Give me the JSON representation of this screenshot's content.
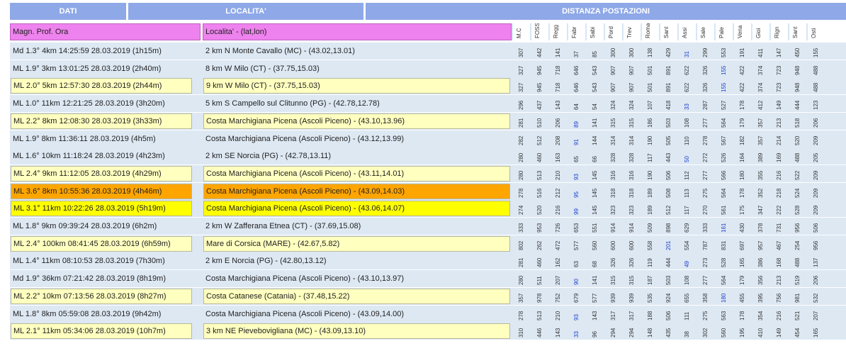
{
  "header": {
    "dati": "DATI",
    "localita": "LOCALITA'",
    "distanza": "DISTANZA POSTAZIONI"
  },
  "columns": {
    "c1": "Magn. Prof. Ora",
    "c2": "Localita' - (lat,lon)"
  },
  "stations": [
    "M.C",
    "FOSS",
    "Regg",
    "Fabr",
    "Sabi",
    "Pord",
    "Trev",
    "Roma",
    "Sant",
    "Assi",
    "Sale",
    "Pale",
    "Vena",
    "Gioi",
    "Rign",
    "Sant",
    "Osti"
  ],
  "colors": {
    "header_blue": "#8ea8e8",
    "magenta": "#ee82ee",
    "row_bg": "#dde8f3",
    "pale_yellow": "#ffffc0",
    "orange": "#ffa500",
    "yellow": "#ffff00",
    "blue_number": "#1a3dcc"
  },
  "rows": [
    {
      "info": "Md 1.3° 4km 14:25:59 28.03.2019 (1h15m)",
      "loc": "2 km N Monte Cavallo (MC) - (43.02,13.01)",
      "hl": "",
      "blue": 9,
      "d": [
        "307",
        "442",
        "141",
        "37",
        "85",
        "300",
        "300",
        "138",
        "429",
        "31",
        "299",
        "553",
        "191",
        "411",
        "147",
        "450",
        "155"
      ]
    },
    {
      "info": "ML 1.9° 3km 13:01:25 28.03.2019 (2h40m)",
      "loc": "8 km W Milo (CT) - (37.75,15.03)",
      "hl": "",
      "blue": 11,
      "d": [
        "327",
        "945",
        "718",
        "646",
        "543",
        "907",
        "907",
        "501",
        "891",
        "622",
        "326",
        "155",
        "422",
        "374",
        "723",
        "948",
        "488"
      ]
    },
    {
      "info": "ML 2.0° 5km 12:57:30 28.03.2019 (2h44m)",
      "loc": "9 km W Milo (CT) - (37.75,15.03)",
      "hl": "pale",
      "blue": 11,
      "d": [
        "327",
        "945",
        "718",
        "646",
        "543",
        "907",
        "907",
        "501",
        "891",
        "622",
        "326",
        "155",
        "422",
        "374",
        "723",
        "948",
        "488"
      ]
    },
    {
      "info": "ML 1.0° 11km 12:21:25 28.03.2019 (3h20m)",
      "loc": "5 km S Campello sul Clitunno (PG) - (42.78,12.78)",
      "hl": "",
      "blue": 9,
      "d": [
        "296",
        "437",
        "143",
        "64",
        "54",
        "324",
        "324",
        "107",
        "418",
        "33",
        "287",
        "527",
        "178",
        "412",
        "149",
        "444",
        "123"
      ]
    },
    {
      "info": "ML 2.2° 8km 12:08:30 28.03.2019 (3h33m)",
      "loc": "Costa Marchigiana Picena (Ascoli Piceno) - (43.10,13.96)",
      "hl": "pale",
      "blue": 3,
      "d": [
        "281",
        "510",
        "206",
        "89",
        "141",
        "315",
        "315",
        "186",
        "503",
        "108",
        "277",
        "564",
        "179",
        "357",
        "213",
        "518",
        "206"
      ]
    },
    {
      "info": "ML 1.9° 8km 11:36:11 28.03.2019 (4h5m)",
      "loc": "Costa Marchigiana Picena (Ascoli Piceno) - (43.12,13.99)",
      "hl": "",
      "blue": 3,
      "d": [
        "282",
        "512",
        "208",
        "91",
        "144",
        "314",
        "314",
        "190",
        "505",
        "110",
        "278",
        "567",
        "182",
        "357",
        "214",
        "520",
        "209"
      ]
    },
    {
      "info": "ML 1.6° 10km 11:18:24 28.03.2019 (4h23m)",
      "loc": "2 km SE Norcia (PG) - (42.78,13.11)",
      "hl": "",
      "blue": 9,
      "d": [
        "280",
        "460",
        "163",
        "65",
        "66",
        "328",
        "328",
        "117",
        "443",
        "50",
        "272",
        "526",
        "164",
        "389",
        "169",
        "488",
        "205"
      ]
    },
    {
      "info": "ML 2.4° 9km 11:12:05 28.03.2019 (4h29m)",
      "loc": "Costa Marchigiana Picena (Ascoli Piceno) - (43.11,14.01)",
      "hl": "pale",
      "blue": 3,
      "d": [
        "280",
        "513",
        "210",
        "93",
        "145",
        "316",
        "316",
        "190",
        "506",
        "112",
        "277",
        "566",
        "180",
        "355",
        "216",
        "522",
        "209"
      ]
    },
    {
      "info": "ML 3.6° 8km 10:55:36 28.03.2019 (4h46m)",
      "loc": "Costa Marchigiana Picena (Ascoli Piceno) - (43.09,14.03)",
      "hl": "orange",
      "blue": 3,
      "d": [
        "278",
        "516",
        "212",
        "95",
        "145",
        "318",
        "318",
        "189",
        "508",
        "113",
        "275",
        "564",
        "178",
        "352",
        "218",
        "524",
        "209"
      ]
    },
    {
      "info": "ML 3.1° 11km 10:22:26 28.03.2019 (5h19m)",
      "loc": "Costa Marchigiana Picena (Ascoli Piceno) - (43.06,14.07)",
      "hl": "yellow",
      "blue": 3,
      "d": [
        "274",
        "520",
        "216",
        "99",
        "145",
        "323",
        "323",
        "189",
        "512",
        "117",
        "270",
        "561",
        "175",
        "347",
        "222",
        "528",
        "209"
      ]
    },
    {
      "info": "ML 1.8° 9km 09:39:24 28.03.2019 (6h2m)",
      "loc": "2 km W Zafferana Etnea (CT) - (37.69,15.08)",
      "hl": "",
      "blue": 11,
      "d": [
        "333",
        "953",
        "726",
        "653",
        "551",
        "914",
        "914",
        "509",
        "898",
        "629",
        "333",
        "161",
        "430",
        "378",
        "731",
        "956",
        "506"
      ]
    },
    {
      "info": "ML 2.4° 100km 08:41:45 28.03.2019 (6h59m)",
      "loc": "Mare di Corsica (MARE) - (42.67,5.82)",
      "hl": "pale",
      "blue": 8,
      "d": [
        "802",
        "262",
        "472",
        "577",
        "560",
        "600",
        "600",
        "558",
        "201",
        "554",
        "787",
        "831",
        "697",
        "957",
        "467",
        "254",
        "956"
      ]
    },
    {
      "info": "ML 1.4° 11km 08:10:53 28.03.2019 (7h30m)",
      "loc": "2 km E Norcia (PG) - (42.80,13.12)",
      "hl": "",
      "blue": 9,
      "d": [
        "281",
        "460",
        "162",
        "63",
        "68",
        "326",
        "326",
        "119",
        "444",
        "49",
        "273",
        "528",
        "165",
        "386",
        "168",
        "488",
        "137"
      ]
    },
    {
      "info": "Md 1.9° 36km 07:21:42 28.03.2019 (8h19m)",
      "loc": "Costa Marchigiana Picena (Ascoli Piceno) - (43.10,13.97)",
      "hl": "",
      "blue": 3,
      "d": [
        "280",
        "511",
        "207",
        "90",
        "141",
        "315",
        "315",
        "187",
        "503",
        "108",
        "277",
        "564",
        "179",
        "356",
        "213",
        "519",
        "206"
      ]
    },
    {
      "info": "ML 2.2° 10km 07:13:56 28.03.2019 (8h27m)",
      "loc": "Costa Catanese (Catania) - (37.48,15.22)",
      "hl": "pale",
      "blue": 11,
      "d": [
        "357",
        "978",
        "752",
        "679",
        "577",
        "939",
        "939",
        "535",
        "924",
        "655",
        "358",
        "180",
        "455",
        "395",
        "756",
        "981",
        "532"
      ]
    },
    {
      "info": "ML 1.8° 8km 05:59:08 28.03.2019 (9h42m)",
      "loc": "Costa Marchigiana Picena (Ascoli Piceno) - (43.09,14.00)",
      "hl": "",
      "blue": 3,
      "d": [
        "278",
        "513",
        "210",
        "93",
        "143",
        "317",
        "317",
        "188",
        "506",
        "111",
        "275",
        "563",
        "178",
        "354",
        "216",
        "521",
        "207"
      ]
    },
    {
      "info": "ML 2.1° 11km 05:34:06 28.03.2019 (10h7m)",
      "loc": "3 km NE Pievebovigliana (MC) - (43.09,13.10)",
      "hl": "pale",
      "blue": 3,
      "d": [
        "310",
        "446",
        "143",
        "33",
        "96",
        "294",
        "294",
        "148",
        "435",
        "38",
        "302",
        "560",
        "195",
        "410",
        "149",
        "454",
        "165"
      ]
    }
  ]
}
